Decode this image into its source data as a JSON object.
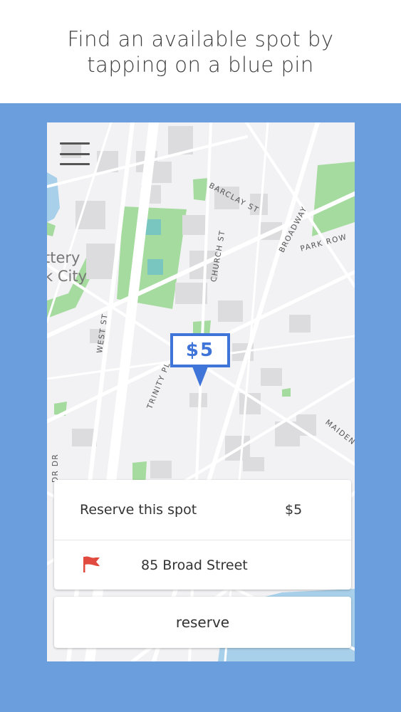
{
  "header": {
    "instruction": "Find an available spot by tapping on a blue pin"
  },
  "map": {
    "streets": {
      "barclay": "BARCLAY ST",
      "church": "CHURCH ST",
      "broadway": "BROADWAY",
      "park_row": "PARK ROW",
      "west": "WEST ST",
      "trinity": "TRINITY PL",
      "maiden": "MAIDEN",
      "dr": "DR DR"
    },
    "city_label": {
      "line1": "ttery",
      "line2": "k City"
    },
    "pin": {
      "price": "$5",
      "color": "#3f74d8"
    }
  },
  "icons": {
    "menu": "hamburger-menu-icon",
    "flag": "red-flag-icon"
  },
  "card": {
    "reserve_label": "Reserve this spot",
    "price": "$5",
    "address": "85 Broad Street"
  },
  "reserve_button": {
    "label": "reserve"
  },
  "colors": {
    "background_blue": "#6b9edc",
    "pin_blue": "#3f74d8",
    "flag_red": "#e04a3f",
    "park_green": "#a6dba0",
    "water_blue": "#a9d0ea"
  }
}
